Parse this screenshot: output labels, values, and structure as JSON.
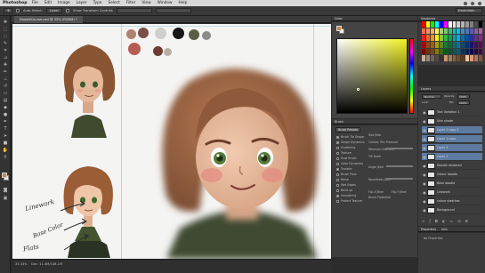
{
  "menubar": {
    "app_name": "Photoshop",
    "items": [
      "File",
      "Edit",
      "Image",
      "Layer",
      "Type",
      "Select",
      "Filter",
      "View",
      "Window",
      "Help"
    ]
  },
  "options_bar": {
    "auto_select_label": "Auto-Select:",
    "auto_select_value": "Layer",
    "show_transform_label": "Show Transform Controls",
    "workspace_label": "Essentials"
  },
  "document": {
    "tab_title": "DoodleCourse.psd @ 33% (RGB/8) *",
    "zoom": "33.33%",
    "doc_info": "Doc: 11.4M/148.1M",
    "annotations": [
      "Linework",
      "Base Color",
      "Flats"
    ]
  },
  "panels": {
    "color_tab": "Color",
    "swatches_tab": "Swatches",
    "brush_tab": "Brush",
    "brush_presets_button": "Brush Presets",
    "brush_options": [
      "Brush Tip Shape",
      "Shape Dynamics",
      "Scattering",
      "Texture",
      "Dual Brush",
      "Color Dynamics",
      "Transfer",
      "Brush Pose",
      "Noise",
      "Wet Edges",
      "Build-up",
      "Smoothing",
      "Protect Texture"
    ],
    "brush_right_labels": [
      "Size Jitter",
      "Control: Pen Pressure",
      "Minimum Diameter",
      "Tilt Scale",
      "Angle Jitter",
      "Roundness Jitter",
      "Flip X Jitter",
      "Flip Y Jitter",
      "Brush Projection"
    ],
    "layers_tab": "Layers",
    "blend_mode": "Normal",
    "opacity_label": "Opacity:",
    "opacity_value": "100%",
    "fill_label": "Fill:",
    "fill_value": "100%",
    "lock_label": "Lock:",
    "layers": [
      "Text Variation 1",
      "Skin shade",
      "Layer 1 copy 2",
      "Layer 1 copy",
      "Layer 2",
      "Layer 1",
      "Doodle rendered",
      "Colour doodle",
      "Base doodle",
      "Linework",
      "colour sketches",
      "Background"
    ],
    "properties_tab": "Properties",
    "info_tab": "Info",
    "properties_text": "No Properties"
  },
  "colors": {
    "foreground": "#c58a4a",
    "background": "#eeeeee",
    "color_field_hue": "#f1f21f",
    "layer_selected": "#5d7aa1",
    "palette_circles": [
      "#b08270",
      "#7a4f45",
      "#cfcfcf",
      "#161616",
      "#5b5e45",
      "#8b8b8b",
      "#b55c52",
      "#6c3c34",
      "#b7b1a3"
    ],
    "swatch_grid": [
      "#ff0000",
      "#ffff00",
      "#00ff00",
      "#00ffff",
      "#0000ff",
      "#ff00ff",
      "#ffffff",
      "#e6e6e6",
      "#cccccc",
      "#b3b3b3",
      "#999999",
      "#808080",
      "#4d4d4d",
      "#000000",
      "#f26c4f",
      "#f68e56",
      "#fbaf5d",
      "#fff467",
      "#acd372",
      "#7cc576",
      "#3bb878",
      "#1abbb4",
      "#00bff3",
      "#438ccb",
      "#5574b9",
      "#605ca8",
      "#855fa8",
      "#a763a8",
      "#ed1c24",
      "#f26522",
      "#f7941d",
      "#fff200",
      "#8dc63f",
      "#39b54a",
      "#00a651",
      "#00a99d",
      "#00aeef",
      "#0072bc",
      "#0054a6",
      "#2e3192",
      "#662d91",
      "#92278f",
      "#9e0b0f",
      "#a0410d",
      "#a36209",
      "#aba000",
      "#598527",
      "#1a7b30",
      "#007236",
      "#00746b",
      "#0076a3",
      "#004b80",
      "#003471",
      "#1b1464",
      "#440e62",
      "#630460",
      "#790000",
      "#7b2e00",
      "#7d4900",
      "#827b00",
      "#406618",
      "#005e20",
      "#005826",
      "#005952",
      "#005b7f",
      "#003663",
      "#002157",
      "#0d004c",
      "#32004b",
      "#4b0049",
      "#c7b299",
      "#998675",
      "#736357",
      "#534741",
      "#37302d",
      "#c69c6d",
      "#a67c52",
      "#8c6239",
      "#754c24",
      "#603913",
      "#e9c3a1",
      "#d89a7b",
      "#b7735a",
      "#8f4f3b"
    ]
  }
}
